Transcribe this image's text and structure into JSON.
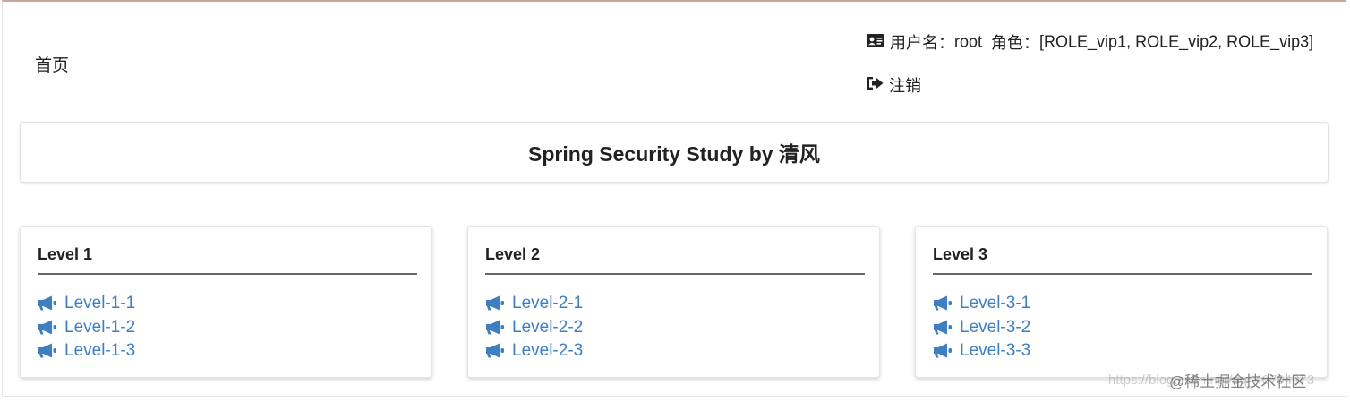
{
  "nav": {
    "home": "首页",
    "user_label": "用户名：",
    "username": "root",
    "role_label": "角色：",
    "roles": "[ROLE_vip1, ROLE_vip2, ROLE_vip3]",
    "logout": "注销"
  },
  "title": "Spring Security Study by 清风",
  "levels": [
    {
      "heading": "Level 1",
      "items": [
        "Level-1-1",
        "Level-1-2",
        "Level-1-3"
      ]
    },
    {
      "heading": "Level 2",
      "items": [
        "Level-2-1",
        "Level-2-2",
        "Level-2-3"
      ]
    },
    {
      "heading": "Level 3",
      "items": [
        "Level-3-1",
        "Level-3-2",
        "Level-3-3"
      ]
    }
  ],
  "watermark": {
    "url": "https://blog.csdn.net/qq_40794973",
    "brand": "@稀土掘金技术社区"
  },
  "colors": {
    "link": "#3d7fc1",
    "text": "#222222"
  },
  "icons": {
    "user": "id-card-icon",
    "logout": "sign-out-icon",
    "item": "bullhorn-icon"
  }
}
